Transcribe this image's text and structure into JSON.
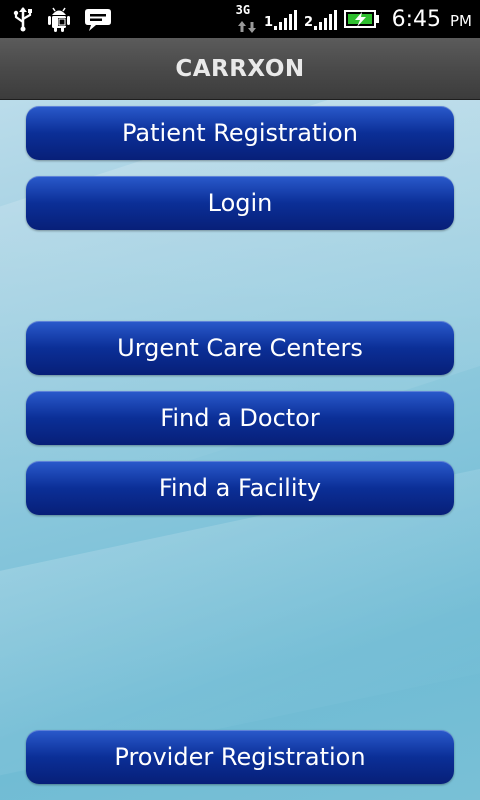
{
  "status_bar": {
    "network": "3G",
    "time": "6:45",
    "ampm": "PM",
    "icons": [
      "usb-icon",
      "android-debug-icon",
      "chat-icon",
      "3g-icon",
      "signal-icon",
      "signal-icon",
      "battery-charging-icon"
    ]
  },
  "app": {
    "title": "CARRXON"
  },
  "buttons": {
    "patient_registration": "Patient Registration",
    "login": "Login",
    "urgent_care": "Urgent Care Centers",
    "find_doctor": "Find a Doctor",
    "find_facility": "Find a Facility",
    "provider_registration": "Provider Registration"
  },
  "colors": {
    "button_top": "#2a5acc",
    "button_bottom": "#071f78",
    "title_bar": "#4a4a4a",
    "background": "#8ac7dc"
  }
}
